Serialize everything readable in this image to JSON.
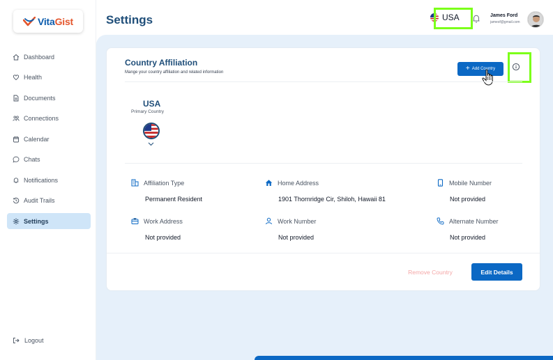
{
  "app": {
    "logo_part1": "Vita",
    "logo_part2": "Gist",
    "brand_color": "#0b5cad",
    "accent_color": "#e4572e"
  },
  "sidebar": {
    "items": [
      {
        "label": "Dashboard",
        "icon": "home-icon"
      },
      {
        "label": "Health",
        "icon": "heart-icon"
      },
      {
        "label": "Documents",
        "icon": "document-icon"
      },
      {
        "label": "Connections",
        "icon": "people-icon"
      },
      {
        "label": "Calendar",
        "icon": "calendar-icon"
      },
      {
        "label": "Chats",
        "icon": "chat-icon"
      },
      {
        "label": "Notifications",
        "icon": "bell-icon"
      },
      {
        "label": "Audit Trails",
        "icon": "history-icon"
      },
      {
        "label": "Settings",
        "icon": "gear-icon",
        "active": true
      }
    ],
    "logout_label": "Logout"
  },
  "header": {
    "title": "Settings",
    "country": "USA",
    "user_name": "James Ford",
    "user_email": "jamesf@gmail.com"
  },
  "card": {
    "title": "Country Affiliation",
    "subtitle": "Mange your country affiliation and related information",
    "add_button": "Add Country",
    "country_name": "USA",
    "country_role": "Primary Country",
    "fields": [
      {
        "label": "Affiliation Type",
        "value": "Permanent Resident",
        "icon": "building-icon"
      },
      {
        "label": "Home Address",
        "value": "1901 Thornridge Cir, Shiloh, Hawaii 81",
        "icon": "house-icon"
      },
      {
        "label": "Mobile Number",
        "value": "Not provided",
        "icon": "phone-icon"
      },
      {
        "label": "Work Address",
        "value": "Not provided",
        "icon": "briefcase-icon"
      },
      {
        "label": "Work Number",
        "value": "Not provided",
        "icon": "user-icon"
      },
      {
        "label": "Alternate Number",
        "value": "Not provided",
        "icon": "call-icon"
      }
    ],
    "remove_button": "Remove Country",
    "edit_button": "Edit Details"
  },
  "highlight_color": "#7cff1a"
}
